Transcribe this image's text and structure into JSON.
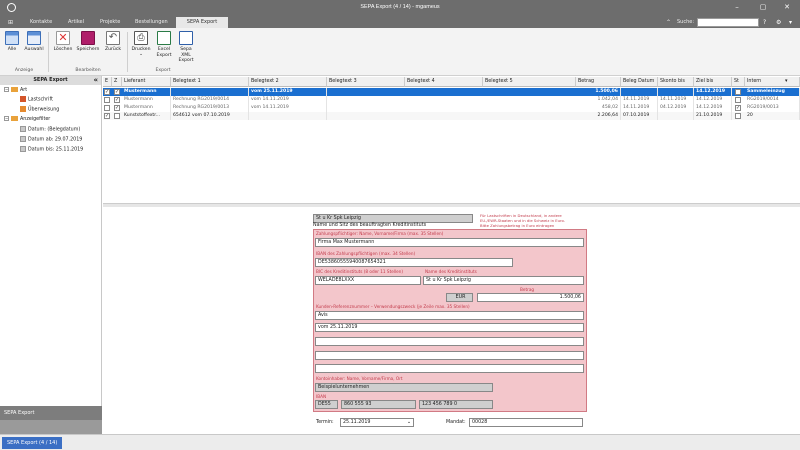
{
  "window": {
    "title": "SEPA Export (4 / 14) - mgameus",
    "minimize": "–",
    "maximize": "▢",
    "close": "✕"
  },
  "menu": {
    "tabs": [
      "Kontakte",
      "Artikel",
      "Projekte",
      "Bestellungen",
      "SEPA Export"
    ],
    "search_label": "Suche:",
    "search_value": ""
  },
  "ribbon": {
    "buttons": [
      "Alle",
      "Auswahl",
      "Löschen",
      "Speichern",
      "Zurück",
      "Drucken",
      "Excel Export",
      "Sepa XML Export"
    ],
    "groups": [
      "Anzeige",
      "Bearbeiten",
      "Export"
    ]
  },
  "left_panel": {
    "header": "SEPA Export",
    "collapse": "«",
    "tree": {
      "art": "Art",
      "lastschrift": "Lastschrift",
      "ueberweisung": "Überweisung",
      "anzeigefilter": "Anzeigefilter",
      "datum": "Datum: (Belegdatum)",
      "datum_ab": "Datum ab: 29.07.2019",
      "datum_bis": "Datum bis: 25.11.2019"
    },
    "footer": "SEPA Export"
  },
  "grid": {
    "headers": [
      "E",
      "Z",
      "Lieferant",
      "Belegtext 1",
      "Belegtext 2",
      "Belegtext 3",
      "Belegtext 4",
      "Belegtext 5",
      "Betrag",
      "Beleg Datum",
      "Skonto bis",
      "Ziel bis",
      "St",
      "Intern"
    ],
    "rows": [
      {
        "e": "✓",
        "z": "✓",
        "lieferant": "Mustermann",
        "b1": "",
        "b2": "vom 25.11.2019",
        "betrag": "1.500,06",
        "beleg": "",
        "skonto": "",
        "ziel": "14.12.2019",
        "st": "",
        "intern": "Sammeleinzug"
      },
      {
        "e": "",
        "z": "✓",
        "lieferant": "Mustermann",
        "b1": "Rechnung RG2019/0014",
        "b2": "vom 14.11.2019",
        "betrag": "1.042,04",
        "beleg": "14.11.2019",
        "skonto": "14.11.2019",
        "ziel": "14.12.2019",
        "st": "",
        "intern": "RG2019/0014"
      },
      {
        "e": "",
        "z": "✓",
        "lieferant": "Mustermann",
        "b1": "Rechnung RG2019/0013",
        "b2": "vom 14.11.2019",
        "betrag": "458,02",
        "beleg": "14.11.2019",
        "skonto": "04.12.2019",
        "ziel": "14.12.2019",
        "st": "✓",
        "intern": "RG2019/0013"
      },
      {
        "e": "✓",
        "z": "",
        "lieferant": "Kunststoffextr...",
        "b1": "654612 vom 07.10.2019",
        "b2": "",
        "betrag": "2.206,64",
        "beleg": "07.10.2019",
        "skonto": "",
        "ziel": "21.10.2019",
        "st": "",
        "intern": "20"
      }
    ]
  },
  "form": {
    "bank_name": "St u Kr Spk Leipzig",
    "bank_caption": "Name und Sitz des beauftragten Kreditinstituts",
    "notice_lines": [
      "Für Lastschriften in Deutschland, in andere",
      "EU-/EWR-Staaten und in die Schweiz in Euro.",
      "Bitte Zahlungsbetrag in Euro eintragen"
    ],
    "zahlungspflichtiger_label": "Zahlungspflichtiger: Name, Vorname/Firma (max. 35 Stellen)",
    "zahlungspflichtiger": "Firma Max Mustermann",
    "iban_label": "IBAN des Zahlungspflichtigen (max. 34 Stellen)",
    "iban": "DE53860555940087654321",
    "bic_label": "BIC des Kreditinstituts (8 oder 11 Stellen)",
    "bic": "WELADE8LXXX",
    "kreditinstitut_label": "Name des Kreditinstituts",
    "kreditinstitut": "St u Kr Spk Leipzig",
    "betrag_label": "Betrag",
    "waehrung": "EUR",
    "betrag": "1.500,06",
    "referenz_label": "Kunden-Referenznummer – Verwendungszweck (je Zeile max. 35 Stellen)",
    "referenz_lines": [
      "Avis",
      "vom 25.11.2019",
      "",
      "",
      ""
    ],
    "empfaenger_label": "Kontoinhaber: Name, Vorname/Firma, Ort",
    "empfaenger": "Beispielunternehmen",
    "iban2_label": "IBAN",
    "iban2_parts": [
      "DE55",
      "860 555 93",
      "123 456 789 0"
    ],
    "termin_label": "Termin:",
    "termin": "25.11.2019",
    "mandat_label": "Mandat:",
    "mandat": "00028"
  },
  "status": {
    "tab": "SEPA Export (4 / 14)"
  }
}
